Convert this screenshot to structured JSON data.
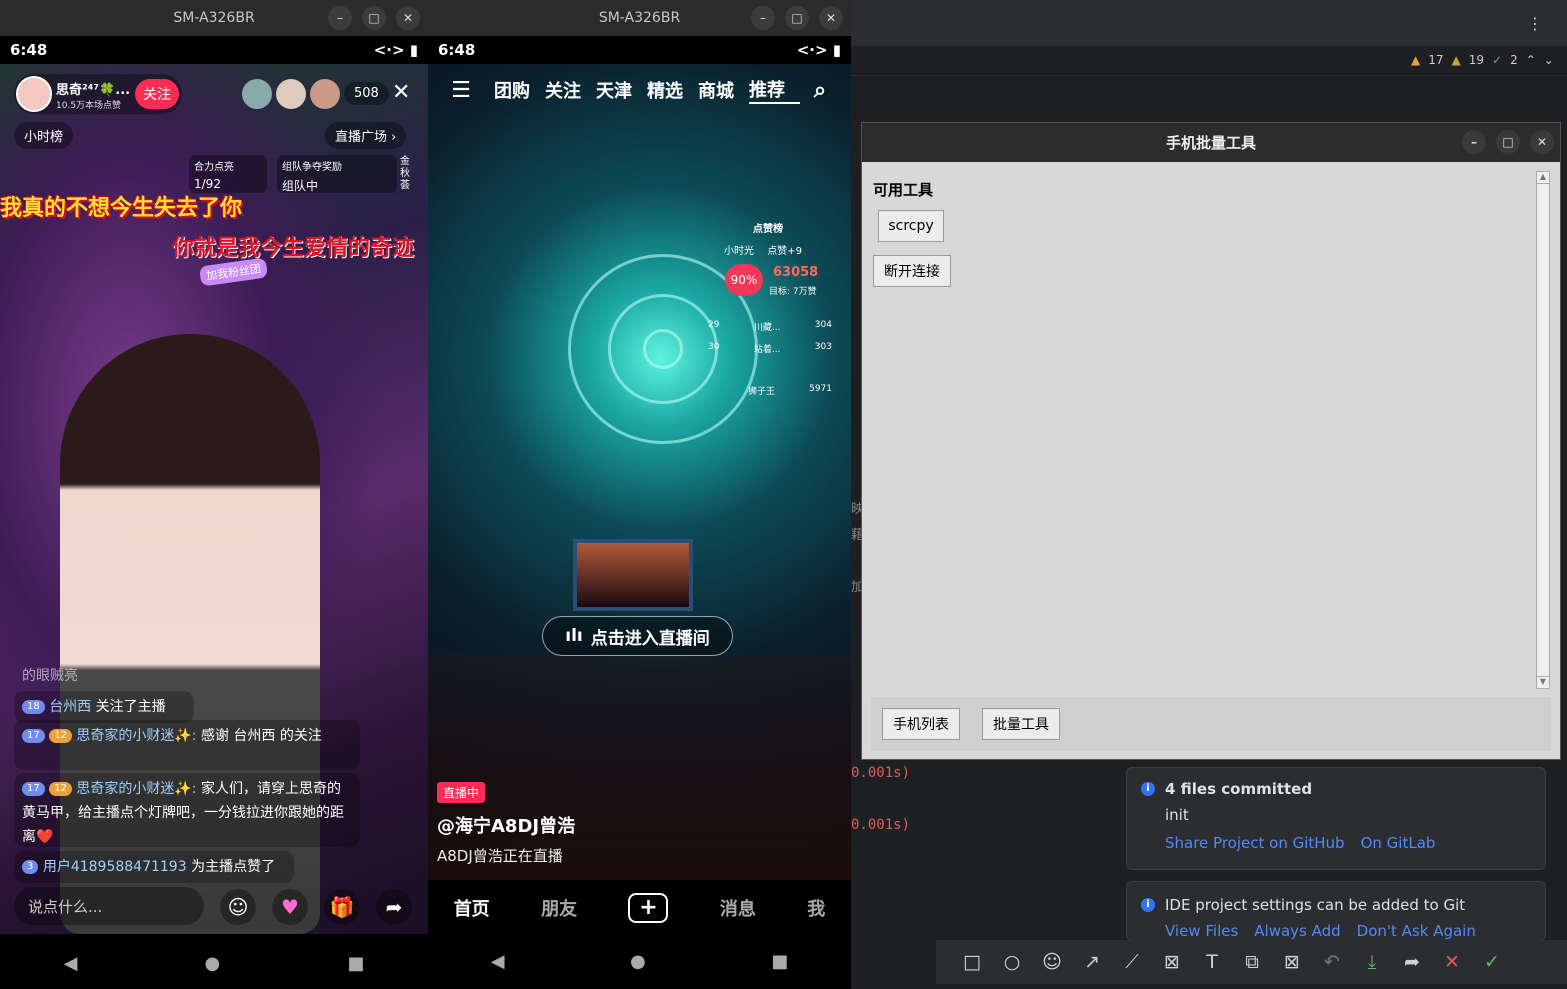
{
  "phone1": {
    "window_title": "SM-A326BR",
    "time": "6:48",
    "host": {
      "name": "思奇²⁴⁷🍀...",
      "likes": "10.5万本场点赞",
      "follow_label": "关注"
    },
    "viewers_count": "508",
    "hourly_rank": "小时榜",
    "live_plaza": "直播广场",
    "light_up": {
      "label": "合力点亮",
      "progress": "1/92"
    },
    "team": {
      "label": "组队争夺奖励",
      "status": "组队中"
    },
    "side_text": "金秋荟",
    "fan_badge": "加我粉丝团",
    "lyric_1": "我真的不想今生失去了你",
    "lyric_2": "你就是我今生爱情的奇迹",
    "chat_faded": "的眼贼亮",
    "chat": [
      {
        "level": "18",
        "user": "台州西",
        "text": "关注了主播"
      },
      {
        "level": "17",
        "badge": "12",
        "user": "思奇家的小财迷✨:",
        "text": "感谢 台州西 的关注"
      },
      {
        "level": "17",
        "badge": "12",
        "user": "思奇家的小财迷✨:",
        "text": "家人们，请穿上思奇的黄马甲，给主播点个灯牌吧，一分钱拉进你跟她的距离❤️"
      },
      {
        "level": "3",
        "user": "用户4189588471193",
        "text": "为主播点赞了"
      }
    ],
    "input_placeholder": "说点什么..."
  },
  "phone2": {
    "window_title": "SM-A326BR",
    "time": "6:48",
    "tabs": [
      "团购",
      "关注",
      "天津",
      "精选",
      "商城",
      "推荐"
    ],
    "active_tab": "推荐",
    "live_stats": {
      "header": "点赞榜",
      "user": "小时光",
      "likes_plus": "点赞+9",
      "percent": "90%",
      "score": "63058",
      "goal": "目标: 7万赞",
      "rank_rows": [
        {
          "rank": "29",
          "name": "川藏...",
          "score": "304"
        },
        {
          "rank": "30",
          "name": "站着...",
          "score": "303"
        },
        {
          "rank": "",
          "name": "狮子王",
          "score": "5971"
        }
      ]
    },
    "enter_live": "点击进入直播间",
    "live_badge": "直播中",
    "streamer": "@海宁A8DJ曾浩",
    "caption": "A8DJ曾浩正在直播",
    "bottom_nav": {
      "home": "首页",
      "friends": "朋友",
      "messages": "消息",
      "me": "我"
    }
  },
  "ide": {
    "inspections": {
      "warn1": "17",
      "warn2": "19",
      "ok": "2"
    },
    "console_lines": [
      "0.001s)",
      "0.001s)"
    ],
    "side_chars": [
      "映",
      "藉",
      "加"
    ]
  },
  "dialog": {
    "title": "手机批量工具",
    "section_label": "可用工具",
    "scrcpy_button": "scrcpy",
    "disconnect_button": "断开连接",
    "tab_phone_list": "手机列表",
    "tab_batch_tools": "批量工具"
  },
  "notifications": [
    {
      "title": "4 files committed",
      "body": "init",
      "links": [
        "Share Project on GitHub",
        "On GitLab"
      ]
    },
    {
      "title": "IDE project settings can be added to Git",
      "links": [
        "View Files",
        "Always Add",
        "Don't Ask Again"
      ]
    }
  ],
  "colors": {
    "accent_red": "#fe2c55",
    "ide_bg": "#1e1f22",
    "link_blue": "#548af7"
  }
}
